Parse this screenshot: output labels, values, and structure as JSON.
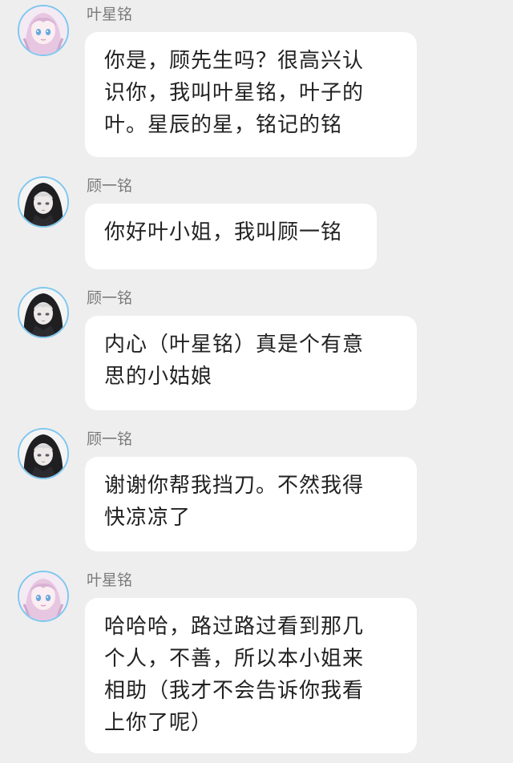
{
  "messages": [
    {
      "sender": "叶星铭",
      "avatar": "anime-girl-avatar",
      "lines": [
        "你是，顾先生吗？很高兴认",
        "识你，我叫叶星铭，叶子的",
        "叶。星辰的星，铭记的铭"
      ]
    },
    {
      "sender": "顾一铭",
      "avatar": "hooded-boy-avatar",
      "lines": [
        "你好叶小姐，我叫顾一铭"
      ]
    },
    {
      "sender": "顾一铭",
      "avatar": "hooded-boy-avatar",
      "lines": [
        "内心（叶星铭）真是个有意",
        "思的小姑娘"
      ]
    },
    {
      "sender": "顾一铭",
      "avatar": "hooded-boy-avatar",
      "lines": [
        "谢谢你帮我挡刀。不然我得",
        "快凉凉了"
      ]
    },
    {
      "sender": "叶星铭",
      "avatar": "anime-girl-avatar",
      "lines": [
        "哈哈哈，路过路过看到那几",
        "个人，不善，所以本小姐来",
        "相助（我才不会告诉你我看",
        "上你了呢）"
      ]
    }
  ],
  "colors": {
    "background": "#eeeeef",
    "bubble": "#ffffff",
    "avatar_ring": "#7fc7ee",
    "sender_text": "#7b7b7b"
  }
}
